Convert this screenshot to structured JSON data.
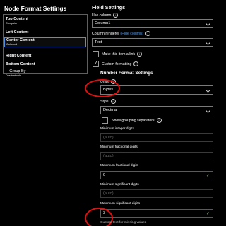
{
  "left": {
    "title": "Node Format Settings",
    "slots": [
      {
        "label": "Top Content",
        "value": "Computer"
      },
      {
        "label": "Left Content",
        "value": ""
      },
      {
        "label": "Center Content",
        "value": "Column1"
      },
      {
        "label": "Right Content",
        "value": ""
      },
      {
        "label": "Bottom Content",
        "value": ""
      },
      {
        "label": "-- Group By --",
        "value": "DestinationIp"
      }
    ],
    "selected_index": 2
  },
  "right": {
    "title": "Field Settings",
    "use_column": {
      "label": "Use column",
      "value": "Column1"
    },
    "column_renderer": {
      "label": "Column renderer",
      "link": "(Hide column)",
      "value": "Text"
    },
    "make_link": {
      "label": "Make this item a link",
      "checked": false
    },
    "custom_formatting": {
      "label": "Custom formatting",
      "checked": true
    },
    "number_format": {
      "title": "Number Format Settings",
      "units": {
        "label": "Units",
        "value": "Bytes"
      },
      "style": {
        "label": "Style",
        "value": "Decimal"
      },
      "show_grouping": {
        "label": "Show grouping separators",
        "checked": false
      },
      "min_integer": {
        "label": "Minimum integer digits",
        "placeholder": "(auto)"
      },
      "min_fractional": {
        "label": "Minimum fractional digits",
        "placeholder": "(auto)"
      },
      "max_fractional": {
        "label": "Maximum fractional digits",
        "value": "0"
      },
      "min_significant": {
        "label": "Minimum significant digits",
        "placeholder": "(auto)"
      },
      "max_significant": {
        "label": "Maximum significant digits",
        "value": "3"
      },
      "missing_values": {
        "label": "Custom text for missing values"
      }
    }
  },
  "colors": {
    "background": "#000000",
    "accent_blue": "#4d8fe0",
    "valid_green": "#7ab85c",
    "annotation_red": "#e01010"
  }
}
